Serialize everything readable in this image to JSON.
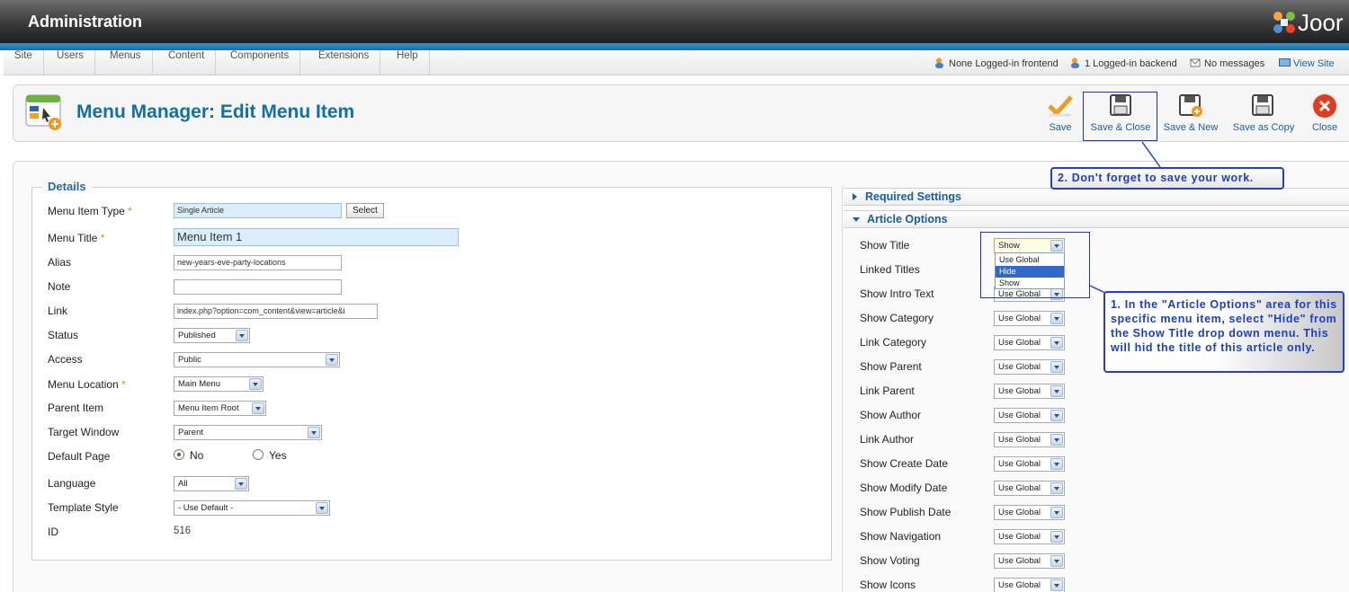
{
  "header": {
    "title": "Administration",
    "logo_text": "Joor"
  },
  "menubar": {
    "items": [
      "Site",
      "Users",
      "Menus",
      "Content",
      "Components",
      "Extensions",
      "Help"
    ],
    "status": {
      "frontend": "None Logged-in frontend",
      "backend": "1 Logged-in backend",
      "messages": "No messages",
      "view_site": "View Site"
    }
  },
  "toolbar": {
    "title": "Menu Manager: Edit Menu Item",
    "buttons": {
      "save": "Save",
      "save_close": "Save & Close",
      "save_new": "Save & New",
      "save_copy": "Save as Copy",
      "close": "Close"
    }
  },
  "details": {
    "legend": "Details",
    "labels": {
      "type": "Menu Item Type",
      "title": "Menu Title",
      "alias": "Alias",
      "note": "Note",
      "link": "Link",
      "status": "Status",
      "access": "Access",
      "location": "Menu Location",
      "parent": "Parent Item",
      "target": "Target Window",
      "default": "Default Page",
      "language": "Language",
      "template": "Template Style",
      "id": "ID"
    },
    "required_mark": "*",
    "values": {
      "type": "Single Article",
      "title": "Menu Item 1",
      "alias": "new-years-eve-party-locations",
      "note": "",
      "link": "index.php?option=com_content&view=article&i",
      "status": "Published",
      "access": "Public",
      "location": "Main Menu",
      "parent": "Menu Item Root",
      "target": "Parent",
      "language": "All",
      "template": "- Use Default -",
      "id": "516"
    },
    "select_button": "Select",
    "default_no": "No",
    "default_yes": "Yes"
  },
  "right": {
    "required_settings": "Required Settings",
    "article_options": "Article Options",
    "options": [
      {
        "label": "Show Title",
        "value": "Show"
      },
      {
        "label": "Linked Titles",
        "value": "Use Global"
      },
      {
        "label": "Show Intro Text",
        "value": "Use Global"
      },
      {
        "label": "Show Category",
        "value": "Use Global"
      },
      {
        "label": "Link Category",
        "value": "Use Global"
      },
      {
        "label": "Show Parent",
        "value": "Use Global"
      },
      {
        "label": "Link Parent",
        "value": "Use Global"
      },
      {
        "label": "Show Author",
        "value": "Use Global"
      },
      {
        "label": "Link Author",
        "value": "Use Global"
      },
      {
        "label": "Show Create Date",
        "value": "Use Global"
      },
      {
        "label": "Show Modify Date",
        "value": "Use Global"
      },
      {
        "label": "Show Publish Date",
        "value": "Use Global"
      },
      {
        "label": "Show Navigation",
        "value": "Use Global"
      },
      {
        "label": "Show Voting",
        "value": "Use Global"
      },
      {
        "label": "Show Icons",
        "value": "Use Global"
      }
    ],
    "dropdown_options": [
      "Use Global",
      "Hide",
      "Show"
    ]
  },
  "callouts": {
    "save_note": "2. Don't forget to save your work.",
    "hide_note": "1. In the \"Article Options\" area for this specific menu item, select \"Hide\" from the Show Title drop down menu. This will hid the title of this article only."
  },
  "colors": {
    "accent": "#136fa7",
    "callout_border": "#2440c8",
    "selected_option": "#3169c6"
  }
}
